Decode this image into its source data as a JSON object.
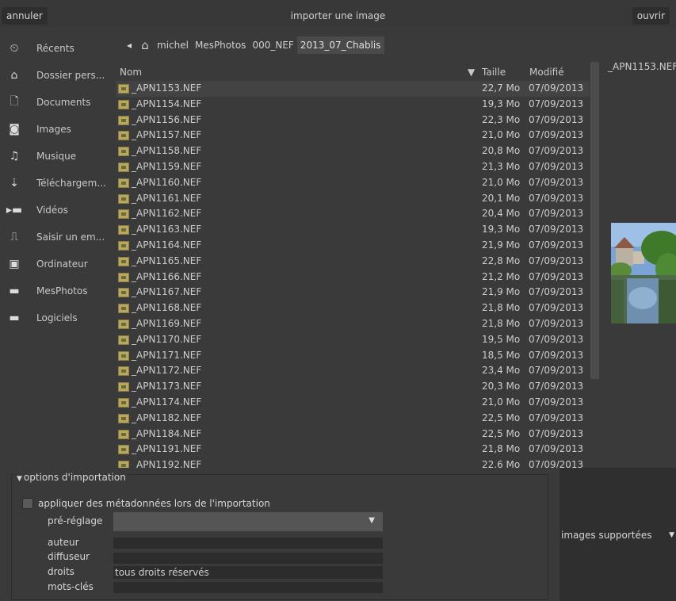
{
  "header": {
    "cancel_label": "annuler",
    "title": "importer une image",
    "open_label": "ouvrir"
  },
  "sidebar": {
    "items": [
      {
        "icon": "clock-icon",
        "glyph": "⏲",
        "label": "Récents"
      },
      {
        "icon": "home-icon",
        "glyph": "⌂",
        "label": "Dossier pers..."
      },
      {
        "icon": "document-icon",
        "glyph": "🗋",
        "label": "Documents"
      },
      {
        "icon": "camera-icon",
        "glyph": "◙",
        "label": "Images"
      },
      {
        "icon": "music-icon",
        "glyph": "♫",
        "label": "Musique"
      },
      {
        "icon": "download-icon",
        "glyph": "⇣",
        "label": "Téléchargem..."
      },
      {
        "icon": "video-icon",
        "glyph": "▸▬",
        "label": "Vidéos"
      },
      {
        "icon": "drive-icon",
        "glyph": "⎍",
        "label": "Saisir un em..."
      },
      {
        "icon": "computer-icon",
        "glyph": "▣",
        "label": "Ordinateur"
      },
      {
        "icon": "folder-icon",
        "glyph": "▬",
        "label": "MesPhotos"
      },
      {
        "icon": "folder-icon",
        "glyph": "▬",
        "label": "Logiciels"
      }
    ]
  },
  "pathbar": {
    "back_glyph": "◂",
    "home_glyph": "⌂",
    "segments": [
      "michel",
      "MesPhotos",
      "000_NEF",
      "2013_07_Chablis"
    ]
  },
  "filelist": {
    "col_name": "Nom",
    "col_size": "Taille",
    "col_modified": "Modifié",
    "sort_glyph": "▼",
    "files": [
      {
        "name": "_APN1153.NEF",
        "size": "22,7 Mo",
        "date": "07/09/2013"
      },
      {
        "name": "_APN1154.NEF",
        "size": "19,3 Mo",
        "date": "07/09/2013"
      },
      {
        "name": "_APN1156.NEF",
        "size": "22,3 Mo",
        "date": "07/09/2013"
      },
      {
        "name": "_APN1157.NEF",
        "size": "21,0 Mo",
        "date": "07/09/2013"
      },
      {
        "name": "_APN1158.NEF",
        "size": "20,8 Mo",
        "date": "07/09/2013"
      },
      {
        "name": "_APN1159.NEF",
        "size": "21,3 Mo",
        "date": "07/09/2013"
      },
      {
        "name": "_APN1160.NEF",
        "size": "21,0 Mo",
        "date": "07/09/2013"
      },
      {
        "name": "_APN1161.NEF",
        "size": "20,1 Mo",
        "date": "07/09/2013"
      },
      {
        "name": "_APN1162.NEF",
        "size": "20,4 Mo",
        "date": "07/09/2013"
      },
      {
        "name": "_APN1163.NEF",
        "size": "19,3 Mo",
        "date": "07/09/2013"
      },
      {
        "name": "_APN1164.NEF",
        "size": "21,9 Mo",
        "date": "07/09/2013"
      },
      {
        "name": "_APN1165.NEF",
        "size": "22,8 Mo",
        "date": "07/09/2013"
      },
      {
        "name": "_APN1166.NEF",
        "size": "21,2 Mo",
        "date": "07/09/2013"
      },
      {
        "name": "_APN1167.NEF",
        "size": "21,9 Mo",
        "date": "07/09/2013"
      },
      {
        "name": "_APN1168.NEF",
        "size": "21,8 Mo",
        "date": "07/09/2013"
      },
      {
        "name": "_APN1169.NEF",
        "size": "21,8 Mo",
        "date": "07/09/2013"
      },
      {
        "name": "_APN1170.NEF",
        "size": "19,5 Mo",
        "date": "07/09/2013"
      },
      {
        "name": "_APN1171.NEF",
        "size": "18,5 Mo",
        "date": "07/09/2013"
      },
      {
        "name": "_APN1172.NEF",
        "size": "23,4 Mo",
        "date": "07/09/2013"
      },
      {
        "name": "_APN1173.NEF",
        "size": "20,3 Mo",
        "date": "07/09/2013"
      },
      {
        "name": "_APN1174.NEF",
        "size": "21,0 Mo",
        "date": "07/09/2013"
      },
      {
        "name": "_APN1182.NEF",
        "size": "22,5 Mo",
        "date": "07/09/2013"
      },
      {
        "name": "_APN1184.NEF",
        "size": "22,5 Mo",
        "date": "07/09/2013"
      },
      {
        "name": "_APN1191.NEF",
        "size": "21,8 Mo",
        "date": "07/09/2013"
      },
      {
        "name": "_APN1192.NEF",
        "size": "22,6 Mo",
        "date": "07/09/2013"
      }
    ]
  },
  "preview": {
    "title": "_APN1153.NEF"
  },
  "options": {
    "title": "options d'importation",
    "apply_metadata_label": "appliquer des métadonnées lors de l'importation",
    "preset_label": "pré-réglage",
    "preset_value": "",
    "author_label": "auteur",
    "author_value": "",
    "publisher_label": "diffuseur",
    "publisher_value": "",
    "rights_label": "droits",
    "rights_value": "tous droits réservés",
    "tags_label": "mots-clés",
    "tags_value": ""
  },
  "filter": {
    "label": "images supportées"
  },
  "colors": {
    "background": "#3a3a3a",
    "input_bg": "#2c2c2c",
    "selected_row": "#434343",
    "text": "#cfcfcf"
  }
}
